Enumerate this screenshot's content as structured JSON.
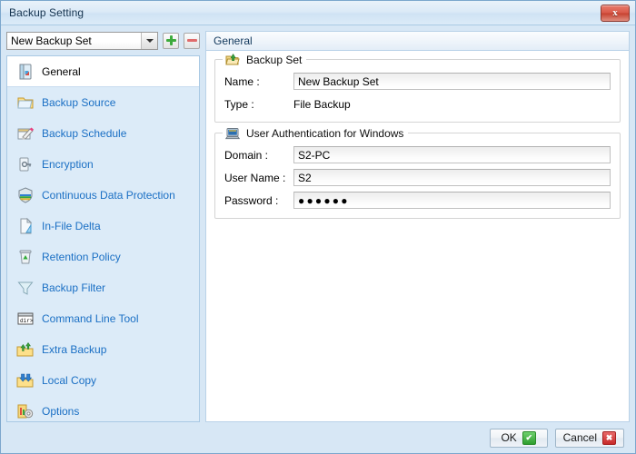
{
  "window": {
    "title": "Backup Setting",
    "close_label": "x"
  },
  "sidebar": {
    "selector": {
      "value": "New Backup Set",
      "add_label": "+",
      "remove_label": "-"
    },
    "items": [
      {
        "label": "General",
        "icon": "general-icon",
        "selected": true
      },
      {
        "label": "Backup Source",
        "icon": "folder-icon",
        "selected": false
      },
      {
        "label": "Backup Schedule",
        "icon": "schedule-icon",
        "selected": false
      },
      {
        "label": "Encryption",
        "icon": "key-icon",
        "selected": false
      },
      {
        "label": "Continuous Data Protection",
        "icon": "shield-icon",
        "selected": false
      },
      {
        "label": "In-File Delta",
        "icon": "delta-icon",
        "selected": false
      },
      {
        "label": "Retention Policy",
        "icon": "recycle-bin-icon",
        "selected": false
      },
      {
        "label": "Backup Filter",
        "icon": "funnel-icon",
        "selected": false
      },
      {
        "label": "Command Line Tool",
        "icon": "console-icon",
        "selected": false
      },
      {
        "label": "Extra Backup",
        "icon": "extra-backup-icon",
        "selected": false
      },
      {
        "label": "Local Copy",
        "icon": "local-copy-icon",
        "selected": false
      },
      {
        "label": "Options",
        "icon": "options-icon",
        "selected": false
      }
    ]
  },
  "panel": {
    "header": "General",
    "backup_set": {
      "title": "Backup Set",
      "icon": "open-folder-up-icon",
      "name_label": "Name :",
      "name_value": "New Backup Set",
      "type_label": "Type :",
      "type_value": "File Backup"
    },
    "user_auth": {
      "title": "User Authentication for Windows",
      "icon": "computer-icon",
      "domain_label": "Domain :",
      "domain_value": "S2-PC",
      "username_label": "User Name :",
      "username_value": "S2",
      "password_label": "Password :",
      "password_value": "●●●●●●"
    }
  },
  "footer": {
    "ok_label": "OK",
    "ok_badge": "✔",
    "cancel_label": "Cancel",
    "cancel_badge": "✖"
  },
  "colors": {
    "window_bg": "#d7e7f5",
    "sidebar_bg": "#dcebf8",
    "link_text": "#1a6fc4",
    "panel_border": "#b9d2e8",
    "title_text": "#15334f"
  }
}
